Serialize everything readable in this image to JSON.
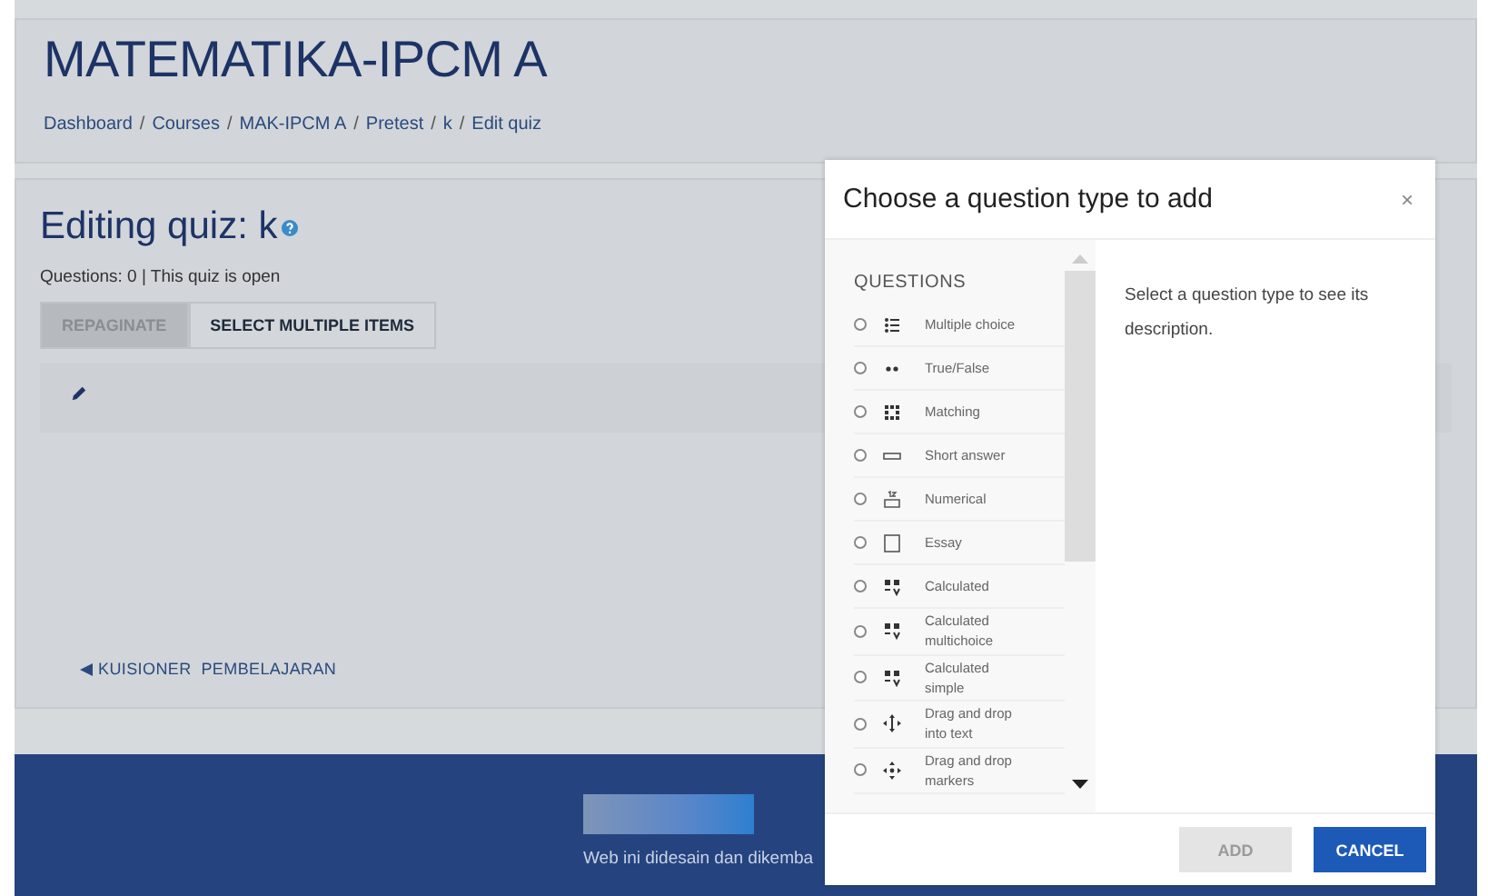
{
  "header": {
    "title": "MATEMATIKA-IPCM A",
    "breadcrumbs": [
      "Dashboard",
      "Courses",
      "MAK-IPCM A",
      "Pretest",
      "k",
      "Edit quiz"
    ],
    "separator": "/"
  },
  "content": {
    "heading": "Editing quiz: k",
    "status": "Questions: 0 | This quiz is open",
    "buttons": [
      {
        "label": "REPAGINATE",
        "disabled": true
      },
      {
        "label": "SELECT MULTIPLE ITEMS",
        "disabled": false
      }
    ],
    "prev_link": "KUISIONER  PEMBELAJARAN"
  },
  "footer": {
    "text": "Web ini didesain dan dikemba"
  },
  "dialog": {
    "title": "Choose a question type to add",
    "close": "×",
    "section": "QUESTIONS",
    "description": "Select a question type to see its description.",
    "options": [
      {
        "kind": "multichoice",
        "label": "Multiple choice",
        "selected": false
      },
      {
        "kind": "truefalse",
        "label": "True/False",
        "selected": false
      },
      {
        "kind": "matching",
        "label": "Matching",
        "selected": false
      },
      {
        "kind": "shortanswer",
        "label": "Short answer",
        "selected": false
      },
      {
        "kind": "numerical",
        "label": "Numerical",
        "selected": false
      },
      {
        "kind": "essay",
        "label": "Essay",
        "selected": false
      },
      {
        "kind": "calculated",
        "label": "Calculated",
        "selected": false
      },
      {
        "kind": "calculated",
        "label": "Calculated multichoice",
        "selected": false
      },
      {
        "kind": "calculated",
        "label": "Calculated simple",
        "selected": false
      },
      {
        "kind": "ddtext",
        "label": "Drag and drop into text",
        "selected": false
      },
      {
        "kind": "ddmarker",
        "label": "Drag and drop markers",
        "selected": false
      }
    ],
    "buttons": [
      {
        "label": "ADD",
        "disabled": true
      },
      {
        "label": "CANCEL",
        "disabled": false
      }
    ]
  }
}
